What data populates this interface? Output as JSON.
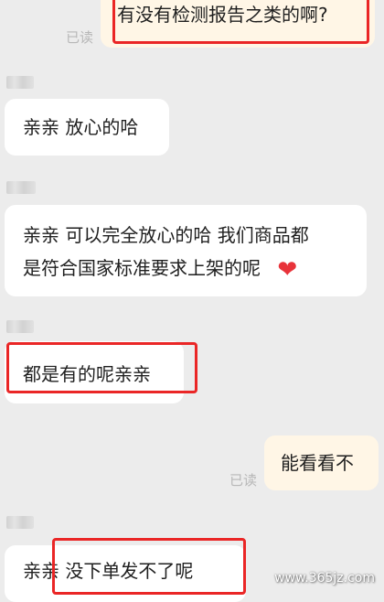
{
  "messages": [
    {
      "type": "sent",
      "text": "有没有检测报告之类的啊?",
      "status": "已读"
    },
    {
      "type": "received",
      "text": "亲亲 放心的哈"
    },
    {
      "type": "received",
      "line1": "亲亲 可以完全放心的哈 我们商品都",
      "line2": "是符合国家标准要求上架的呢",
      "emoji": "❤"
    },
    {
      "type": "received",
      "text": "都是有的呢亲亲"
    },
    {
      "type": "sent",
      "text": "能看看不",
      "status": "已读"
    },
    {
      "type": "received",
      "text": "亲亲 没下单发不了呢"
    }
  ],
  "watermark": "www.365jz.com",
  "colors": {
    "background": "#ececec",
    "bubble_received": "#ffffff",
    "bubble_sent": "#fff6e6",
    "highlight": "#ea2626",
    "heart": "#e8333a"
  }
}
